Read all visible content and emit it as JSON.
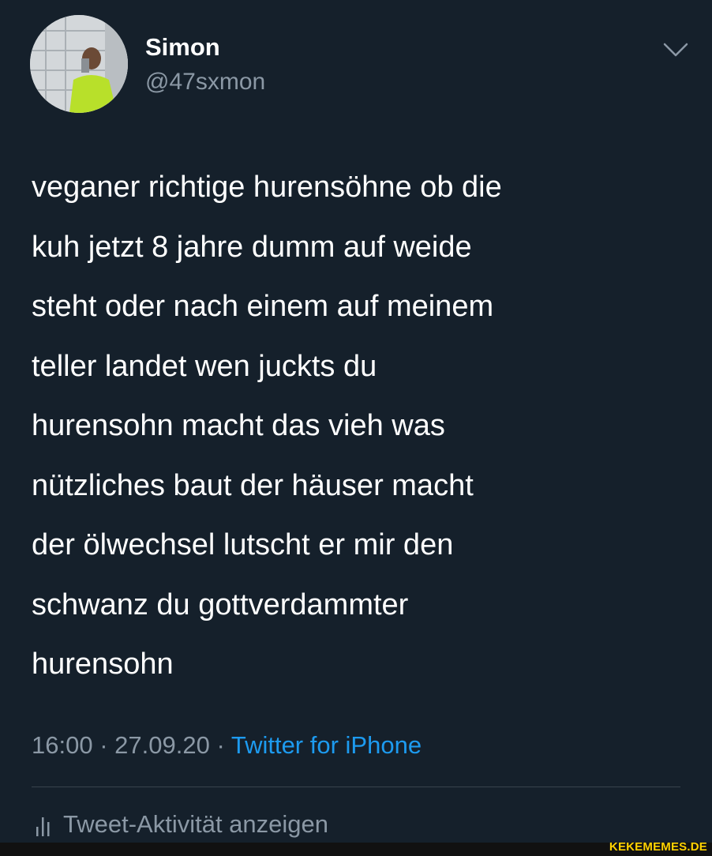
{
  "author": {
    "display_name": "Simon",
    "handle": "@47sxmon",
    "avatar_icon": "profile-photo"
  },
  "tweet": {
    "lines": [
      "veganer richtige hurensöhne ob die",
      "kuh jetzt 8 jahre dumm auf weide",
      "steht oder nach einem auf meinem",
      "teller landet wen juckts du",
      "hurensohn macht das vieh was",
      "nützliches baut der häuser macht",
      "der ölwechsel lutscht er mir den",
      "schwanz du gottverdammter",
      "hurensohn"
    ]
  },
  "meta": {
    "time": "16:00",
    "separator": "·",
    "date": "27.09.20",
    "source": "Twitter for iPhone"
  },
  "activity": {
    "label": "Tweet-Aktivität anzeigen",
    "icon": "bar-chart-icon"
  },
  "watermark": {
    "text": "KEKEMEMES.DE"
  },
  "colors": {
    "background": "#15202b",
    "text": "#ffffff",
    "secondary": "#8b98a5",
    "link": "#1d9bf0",
    "divider": "#38444d",
    "watermark": "#ffd200"
  }
}
